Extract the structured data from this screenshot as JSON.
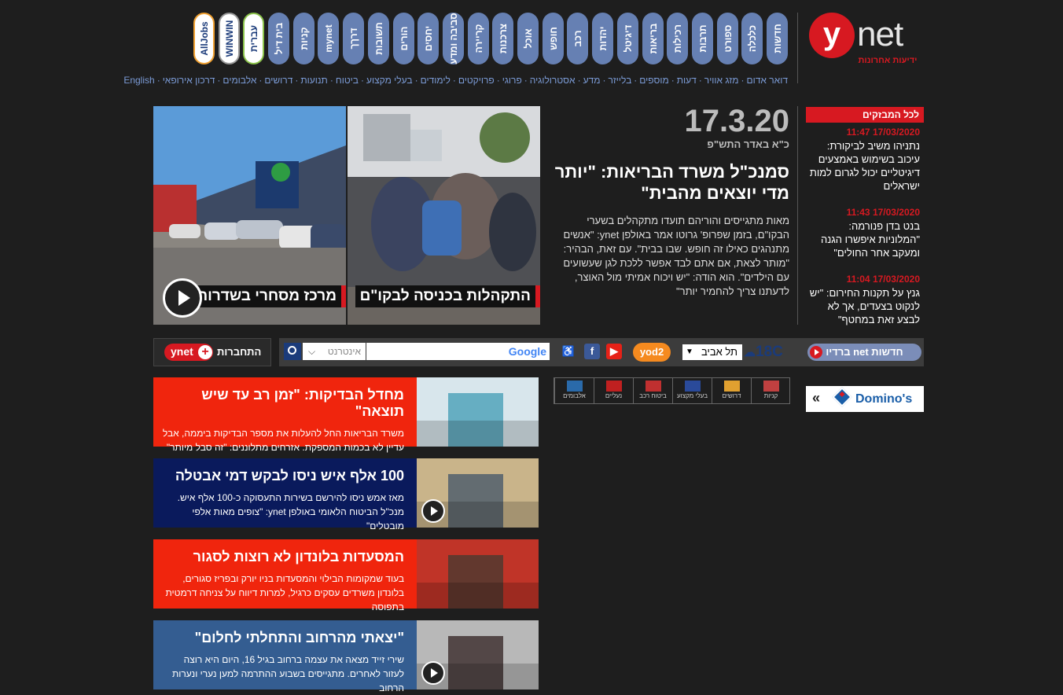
{
  "header": {
    "logo_letter": "y",
    "logo_net": "net",
    "logo_sub": "ידיעות אחרונות",
    "nav": [
      "חדשות",
      "כלכלה",
      "ספורט",
      "תרבות",
      "רכילות",
      "בריאות",
      "דיגיטל",
      "יהדות",
      "רכב",
      "חופש",
      "אוכל",
      "צרכנות",
      "קריירה",
      "סביבה ומדע",
      "יחסים",
      "הורים",
      "תשובות",
      "דרךך",
      "mynet",
      "קניות",
      "בית דיל",
      "עברית",
      "WINWIN",
      "AllJobs"
    ],
    "sublinks": [
      "דואר אדום",
      "מזג אוויר",
      "דעות",
      "מוספים",
      "בלייזר",
      "מדע",
      "אסטרולוגיה",
      "פרוגי",
      "פרויקטים",
      "לימודים",
      "בעלי מקצוע",
      "ביטוח",
      "תנועות",
      "דרושים",
      "אלבומים",
      "דרכון אירופאי",
      "English"
    ]
  },
  "lead": {
    "photo_left_caption": "מרכז מסחרי בשדרות",
    "photo_right_caption": "התקהלות בכניסה לבקו\"ם",
    "date": "17.3.20",
    "hebrew_date": "כ\"א באדר התש\"פ",
    "title": "סמנכ\"ל משרד הבריאות: \"יותר מדי יוצאים מהבית\"",
    "body": "מאות מתגייסים והוריהם תועדו מתקהלים בשערי הבקו\"ם, בזמן שפרופ' גרוטו אמר באולפן ynet: \"אנשים מתנהגים כאילו זה חופש. שבו בבית\". עם זאת, הבהיר: \"מותר לצאת, אם אתם לבד אפשר ללכת לגן שעשועים עם הילדים\". הוא הודה: \"יש ויכוח אמיתי מול האוצר, לדעתנו צריך להחמיר יותר\""
  },
  "breaking": {
    "header": "לכל המבזקים",
    "items": [
      {
        "time": "17/03/2020 11:47",
        "text": "נתניהו משיב לביקורת: עיכוב בשימוש באמצעים דיגיטליים יכול לגרום למות ישראלים"
      },
      {
        "time": "17/03/2020 11:43",
        "text": "בנט בדן פנורמה: \"המלוניות איפשרו הגנה ומעקב אחר החולים\""
      },
      {
        "time": "17/03/2020 11:04",
        "text": "גנץ על תקנות החירום: \"יש לנקוט בצעדים, אך לא לבצע זאת במחטף\""
      }
    ]
  },
  "toolbar": {
    "connect_label": "התחברות",
    "ynet_plus": "ynet",
    "search_select": "אינטרנט",
    "search_brand": "Google",
    "yod2": "yod2",
    "city": "תל אביב",
    "temperature": "18C",
    "radio": "חדשות net ברדיו"
  },
  "stories": [
    {
      "title": "מחדל הבדיקות: \"זמן רב עד שיש תוצאה\"",
      "sub": "משרד הבריאות החל להעלות את מספר הבדיקות ביממה, אבל עדיין לא בכמות המספקת. אזרחים מתלוננים: \"זה סבל מיותר\"",
      "bg": "#f0250d",
      "video": false
    },
    {
      "title": "100 אלף איש ניסו לבקש דמי אבטלה",
      "sub": "מאז אמש ניסו להירשם בשירות התעסוקה כ-100 אלף איש. מנכ\"ל הביטוח הלאומי באולפן ynet: \"צופים מאות אלפי מובטלים\"",
      "bg": "#0a1a5c",
      "video": true
    },
    {
      "title": "המסעדות בלונדון לא רוצות לסגור",
      "sub": "בעוד שמקומות הבילוי והמסעדות בניו יורק ובפריז סגורים, בלונדון משרדים עסקים כרגיל, למרות דיווח על צניחה דרמטית בתפוסה",
      "bg": "#f0250d",
      "video": false
    },
    {
      "title": "\"יצאתי מהרחוב והתחלתי לחלום\"",
      "sub": "שירי זייד מצאה את עצמה ברחוב בגיל 16, היום היא רוצה לעזור לאחרים. מתגייסים בשבוע ההתרמה למען נערי ונערות הרחוב",
      "bg": "#345d91",
      "video": true
    }
  ],
  "categories": [
    "קניות",
    "דרושים",
    "בעלי מקצוע",
    "ביטוח רכב",
    "נעליים",
    "אלבומים"
  ],
  "promo": {
    "label": "Domino's",
    "arrow": "«"
  }
}
